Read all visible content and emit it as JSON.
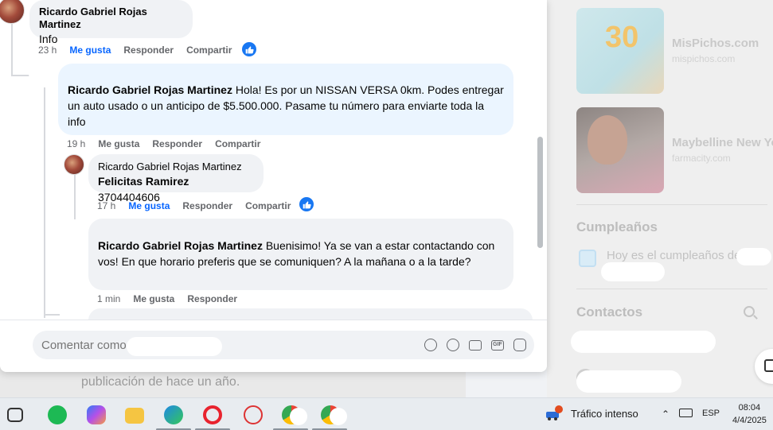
{
  "background": {
    "post_text": "publicación de hace un año.",
    "post_text_partial": "publicación de ... (parcialmente visible)"
  },
  "right_rail": {
    "ads": [
      {
        "title": "MisPichos.com",
        "domain": "mispichos.com",
        "badge": "30"
      },
      {
        "title": "Maybelline New Yo",
        "domain": "farmacity.com"
      }
    ],
    "birthdays_heading": "Cumpleaños",
    "birthdays_text": "Hoy es el cumpleaños de",
    "contacts_heading": "Contactos"
  },
  "comments": [
    {
      "author": "Ricardo Gabriel Rojas Martinez",
      "text": "Info",
      "time": "23 h",
      "like": "Me gusta",
      "reply": "Responder",
      "share": "Compartir",
      "liked": true
    },
    {
      "author": "Ricardo Gabriel Rojas Martinez",
      "text": "Hola! Es por un NISSAN VERSA 0km. Podes entregar un auto usado o un anticipo de $5.500.000. Pasame tu número para enviarte toda la info",
      "time": "19 h",
      "like": "Me gusta",
      "reply": "Responder",
      "share": "Compartir"
    },
    {
      "author": "Ricardo Gabriel Rojas Martinez",
      "mention": "Felicitas Ramirez",
      "text": "3704404606",
      "time": "17 h",
      "like": "Me gusta",
      "reply": "Responder",
      "share": "Compartir",
      "liked": true
    },
    {
      "author": "Ricardo Gabriel Rojas Martinez",
      "text": "Buenisimo! Ya se van a estar contactando con vos! En que horario preferis que se comuniquen? A la mañana o a la tarde?",
      "time": "1 min",
      "like": "Me gusta",
      "reply": "Responder"
    }
  ],
  "partial_comment_text": "Ricardo ... Felicitas Ramirez",
  "composer": {
    "placeholder": "Comentar como"
  },
  "taskbar": {
    "traffic_text": "Tráfico intenso",
    "language": "ESP",
    "time": "08:04",
    "date": "4/4/2025"
  }
}
